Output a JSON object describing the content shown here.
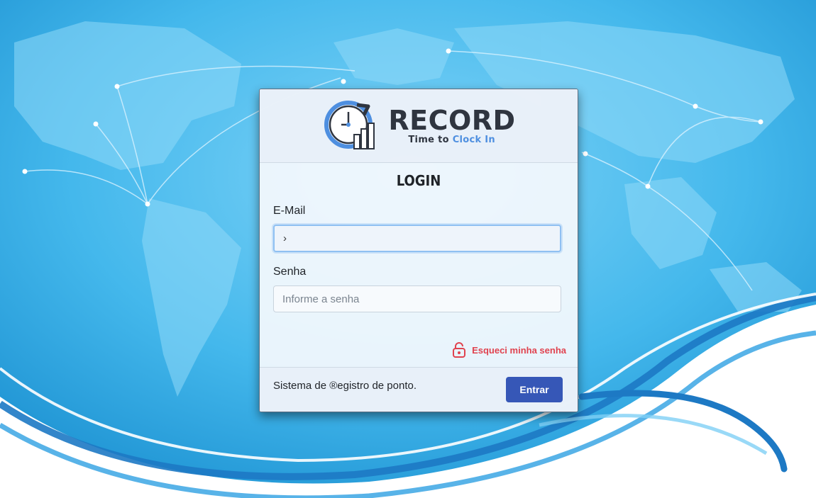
{
  "brand": {
    "name": "RECORD",
    "tagline_part1": "Time to",
    "tagline_part2": "Clock In"
  },
  "login": {
    "title": "LOGIN",
    "email_label": "E-Mail",
    "email_value": "›",
    "password_label": "Senha",
    "password_placeholder": "Informe a senha",
    "forgot_label": "Esqueci minha senha"
  },
  "footer": {
    "text": "Sistema de ®egistro de ponto.",
    "submit_label": "Entrar"
  },
  "colors": {
    "accent": "#3657b7",
    "link": "#e0434f",
    "background": "#3fb6ea"
  }
}
